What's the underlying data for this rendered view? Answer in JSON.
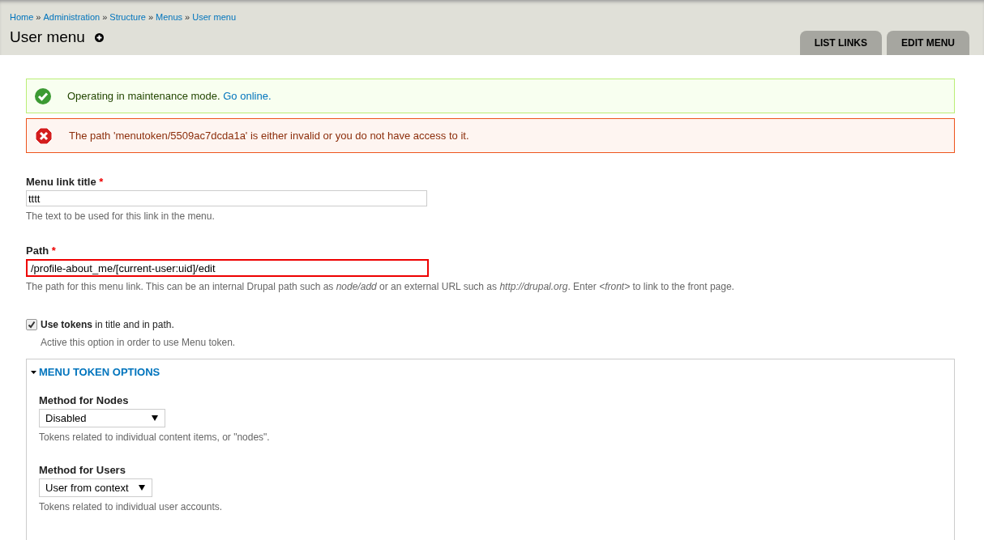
{
  "breadcrumb": [
    "Home",
    "Administration",
    "Structure",
    "Menus",
    "User menu"
  ],
  "breadcrumb_separator": "»",
  "page_title": "User menu",
  "tabs": [
    {
      "label": "LIST LINKS"
    },
    {
      "label": "EDIT MENU"
    }
  ],
  "messages": [
    {
      "kind": "status",
      "text": "Operating in maintenance mode.",
      "link": "Go online."
    },
    {
      "kind": "error",
      "text": "The path 'menutoken/5509ac7dcda1a' is either invalid or you do not have access to it."
    }
  ],
  "fields": [
    {
      "label": "Menu link title",
      "required_mark": "*",
      "value": "tttt",
      "error": false,
      "description": "The text to be used for this link in the menu."
    },
    {
      "label": "Path",
      "required_mark": "*",
      "value": "/profile-about_me/[current-user:uid]/edit",
      "error": true,
      "description": "The path for this menu link. This can be an internal Drupal path such as *node/add* or an external URL such as *http://drupal.org*. Enter *<front>* to link to the front page."
    }
  ],
  "checkbox": {
    "label": "**Use tokens** in title and in path.",
    "checked": true,
    "description": "Active this option in order to use Menu token."
  },
  "fieldset": {
    "legend": "MENU TOKEN OPTIONS",
    "expanded": true,
    "selects": [
      {
        "label": "Method for Nodes",
        "value": "Disabled",
        "description": "Tokens related to individual content items, or \"nodes\"."
      },
      {
        "label": "Method for Users",
        "value": "User from context",
        "description": "Tokens related to individual user accounts."
      }
    ]
  }
}
